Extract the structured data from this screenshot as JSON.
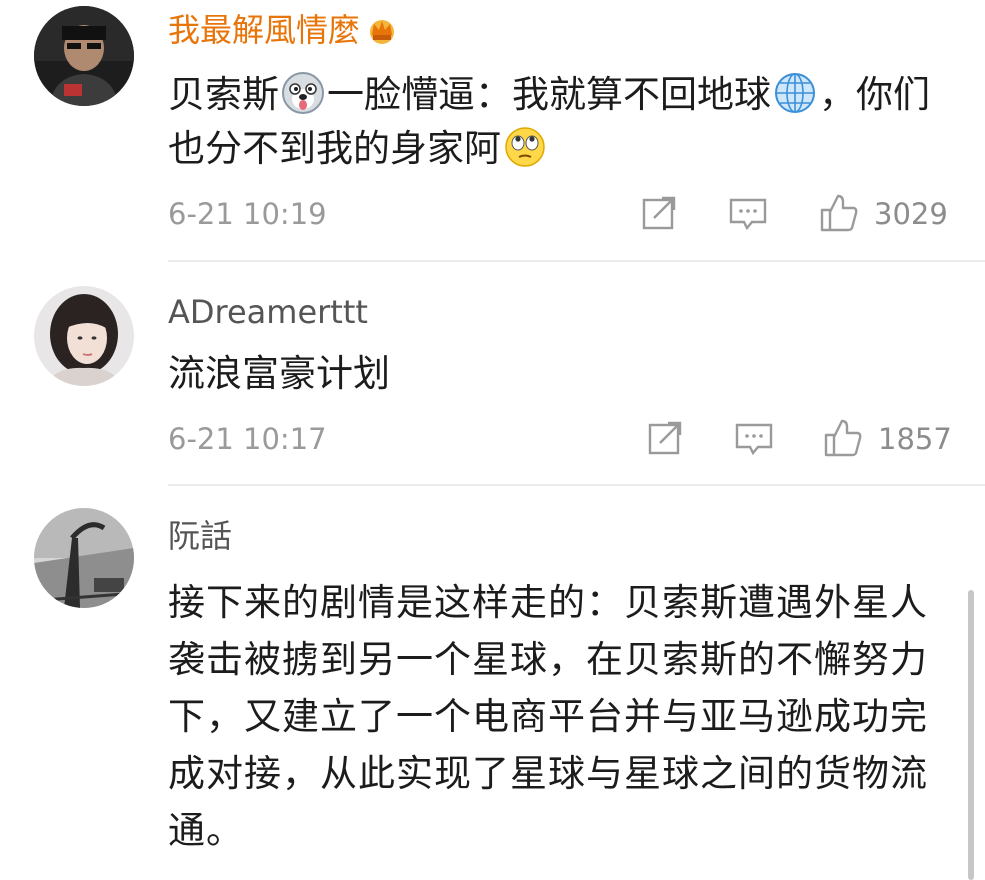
{
  "comments": [
    {
      "username": "我最解風情麼",
      "text_part1": "贝索斯",
      "text_part2": "一脸懵逼：我就算不回地球",
      "text_part3": "，你们也分不到我的身家阿",
      "time": "6-21 10:19",
      "likes": "3029",
      "vip_color": "#e8750a"
    },
    {
      "username": "ADreamerttt",
      "text": "流浪富豪计划",
      "time": "6-21 10:17",
      "likes": "1857"
    },
    {
      "username": "阮話",
      "text": "接下来的剧情是这样走的：贝索斯遭遇外星人袭击被掳到另一个星球，在贝索斯的不懈努力下，又建立了一个电商平台并与亚马逊成功完成对接，从此实现了星球与星球之间的货物流通。"
    }
  ],
  "icons": {
    "share": "share-icon",
    "comment": "comment-icon",
    "like": "thumbs-up-icon",
    "crown": "crown-icon",
    "husky": "husky-face-emoji",
    "globe": "globe-emoji",
    "eyeroll": "eye-roll-emoji"
  }
}
